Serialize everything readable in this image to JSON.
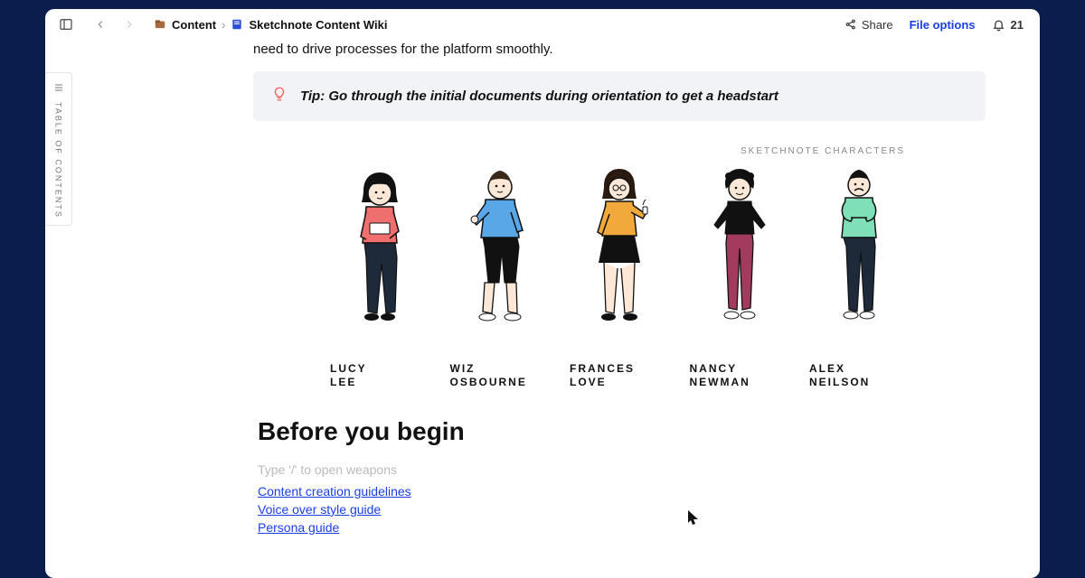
{
  "breadcrumb": {
    "root": "Content",
    "page": "Sketchnote Content Wiki"
  },
  "topbar": {
    "share": "Share",
    "file_options": "File options",
    "notif_count": "21"
  },
  "toc": {
    "label": "TABLE OF CONTENTS"
  },
  "intro": {
    "visible_tail": "need to drive processes for the platform smoothly."
  },
  "tip": {
    "text": "Tip: Go through the initial documents during orientation to get a headstart"
  },
  "characters": {
    "caption": "SKETCHNOTE CHARACTERS",
    "list": [
      {
        "first": "LUCY",
        "last": "LEE"
      },
      {
        "first": "WIZ",
        "last": "OSBOURNE"
      },
      {
        "first": "FRANCES",
        "last": "LOVE"
      },
      {
        "first": "NANCY",
        "last": "NEWMAN"
      },
      {
        "first": "ALEX",
        "last": "NEILSON"
      }
    ]
  },
  "section": {
    "title": "Before you begin",
    "slash_hint": "Type '/' to open weapons",
    "links": [
      "Content creation guidelines",
      "Voice over style guide",
      "Persona guide"
    ]
  }
}
